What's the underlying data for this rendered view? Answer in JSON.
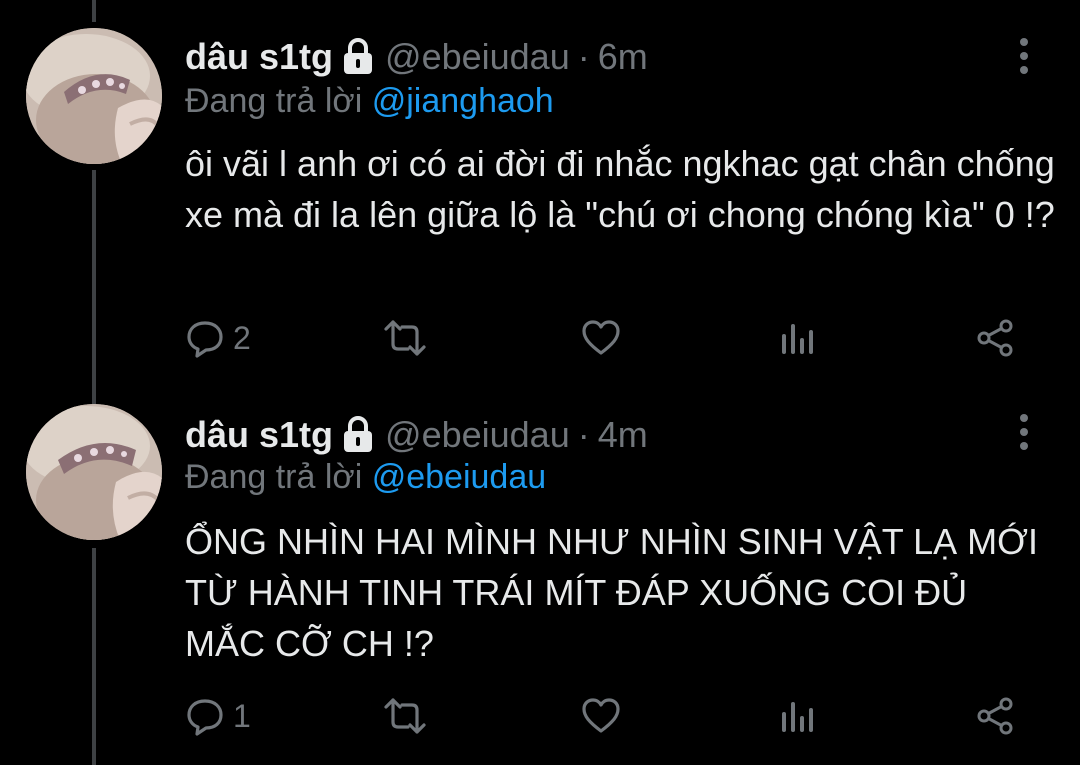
{
  "colors": {
    "background": "#000000",
    "primary_text": "#e7e9ea",
    "secondary_text": "#71767b",
    "accent": "#1d9bf0",
    "thread_line": "#3e4144"
  },
  "tweets": [
    {
      "display_name": "dâu s1tg",
      "protected_icon": "lock-icon",
      "handle": "@ebeiudau",
      "separator": "·",
      "time": "6m",
      "reply_prefix": "Đang trả lời",
      "reply_to": "@jianghaoh",
      "text": "ôi vãi l anh ơi có ai đời đi nhắc ngkhac gạt chân chống xe mà đi la lên giữa lộ là \"chú ơi chong chóng kìa\" 0 !?",
      "reply_count": "2",
      "retweet_count": "",
      "like_count": "",
      "icons": [
        "reply-icon",
        "retweet-icon",
        "heart-icon",
        "analytics-icon",
        "share-icon",
        "more-icon"
      ]
    },
    {
      "display_name": "dâu s1tg",
      "protected_icon": "lock-icon",
      "handle": "@ebeiudau",
      "separator": "·",
      "time": "4m",
      "reply_prefix": "Đang trả lời",
      "reply_to": "@ebeiudau",
      "text": "ỔNG NHÌN HAI MÌNH NHƯ NHÌN SINH VẬT LẠ MỚI TỪ HÀNH TINH TRÁI MÍT ĐÁP XUỐNG COI ĐỦ MẮC CỠ CH !?",
      "reply_count": "1",
      "retweet_count": "",
      "like_count": "",
      "icons": [
        "reply-icon",
        "retweet-icon",
        "heart-icon",
        "analytics-icon",
        "share-icon",
        "more-icon"
      ]
    }
  ]
}
